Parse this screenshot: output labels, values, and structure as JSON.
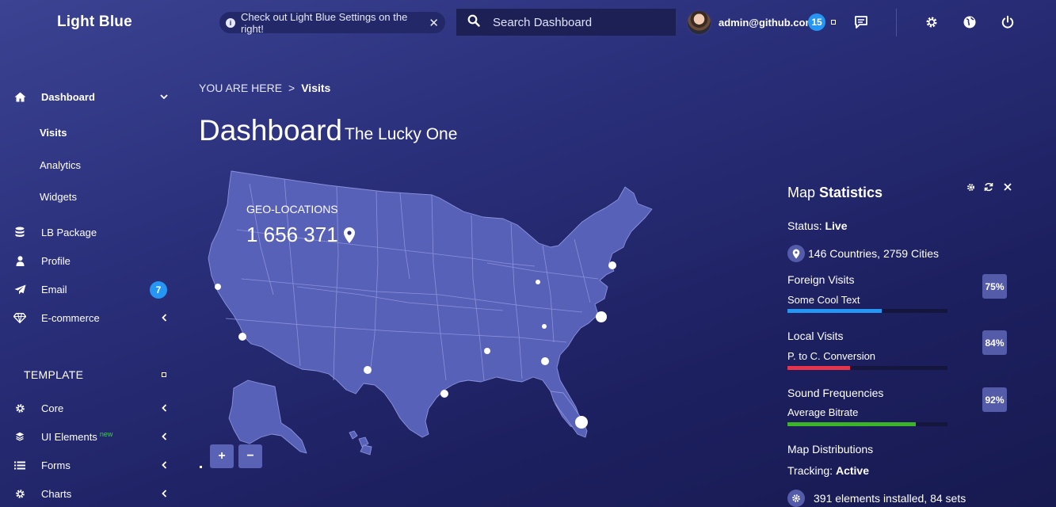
{
  "header": {
    "logo": "Light Blue",
    "alert_text": "Check out Light Blue Settings on the right!",
    "search_placeholder": "Search Dashboard",
    "user_name": "admin@github.com",
    "notifications_count": "15"
  },
  "sidebar": {
    "dashboard_label": "Dashboard",
    "sub_items": [
      "Visits",
      "Analytics",
      "Widgets"
    ],
    "items": [
      {
        "label": "LB Package",
        "icon": "database-icon"
      },
      {
        "label": "Profile",
        "icon": "user-icon"
      },
      {
        "label": "Email",
        "icon": "paper-plane-icon",
        "badge": "7"
      },
      {
        "label": "E-commerce",
        "icon": "diamond-icon"
      }
    ],
    "section_title": "TEMPLATE",
    "template_items": [
      {
        "label": "Core",
        "icon": "gear-icon"
      },
      {
        "label": "UI Elements",
        "icon": "layers-icon",
        "tag": "new"
      },
      {
        "label": "Forms",
        "icon": "list-icon"
      },
      {
        "label": "Charts",
        "icon": "gear-icon"
      }
    ]
  },
  "breadcrumb": {
    "prefix": "YOU ARE HERE",
    "separator": ">",
    "current": "Visits"
  },
  "page": {
    "title": "Dashboard",
    "subtitle": "The Lucky One"
  },
  "map": {
    "geo_label": "GEO-LOCATIONS",
    "geo_value": "1 656 371",
    "zoom_in": "+",
    "zoom_out": "−",
    "fill_color": "#5861b8",
    "stroke_color": "#8a92db"
  },
  "stats_panel": {
    "title_light": "Map",
    "title_bold": "Statistics",
    "status_label": "Status:",
    "status_value": "Live",
    "countries_text": "146 Countries, 2759 Cities",
    "metrics": [
      {
        "label": "Foreign Visits",
        "sub": "Some Cool Text",
        "percent": "75%",
        "value": 0.59,
        "color": "#2596f3"
      },
      {
        "label": "Local Visits",
        "sub": "P. to C. Conversion",
        "percent": "84%",
        "value": 0.39,
        "color": "#e8344a"
      },
      {
        "label": "Sound Frequencies",
        "sub": "Average Bitrate",
        "percent": "92%",
        "value": 0.8,
        "color": "#3cb428"
      }
    ],
    "distributions_label": "Map Distributions",
    "tracking_label": "Tracking:",
    "tracking_value": "Active",
    "elements_text": "391 elements installed, 84 sets"
  }
}
